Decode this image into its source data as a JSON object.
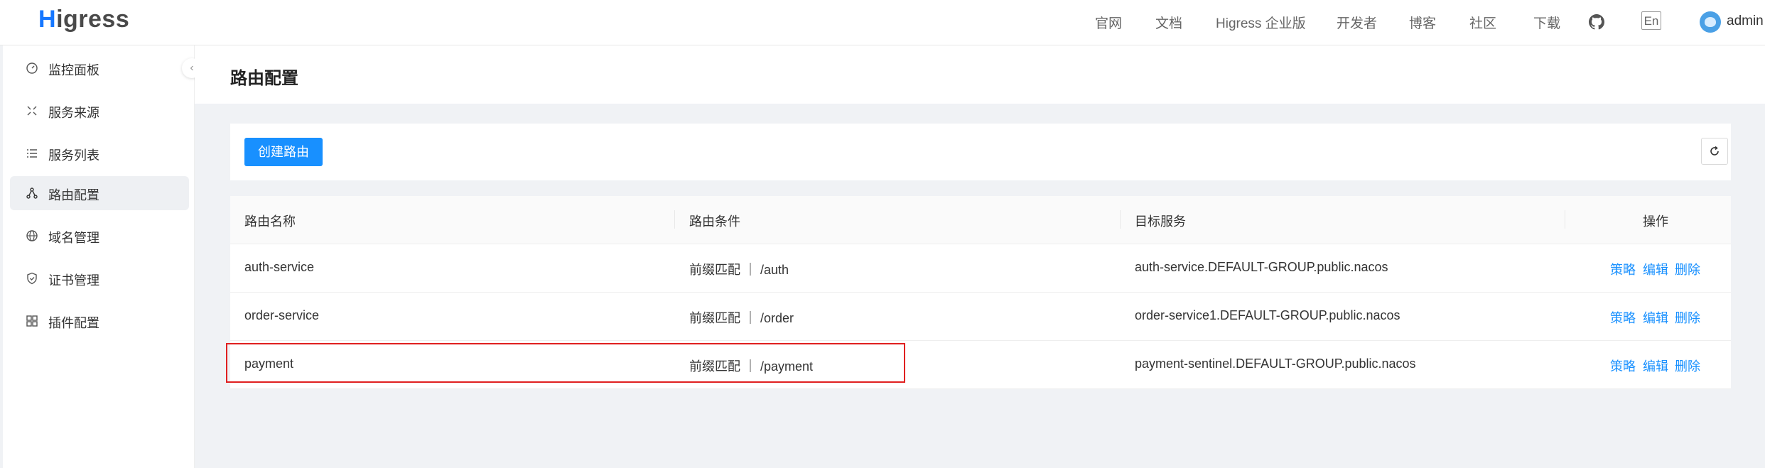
{
  "brand": {
    "logo_h": "H",
    "logo_rest": "igress"
  },
  "topnav": {
    "items": [
      "官网",
      "文档",
      "Higress 企业版",
      "开发者",
      "博客",
      "社区",
      "下载"
    ],
    "github_icon": "github-icon",
    "lang": "En",
    "user": "admin"
  },
  "sidebar": {
    "items": [
      {
        "label": "监控面板",
        "icon": "dashboard-icon"
      },
      {
        "label": "服务来源",
        "icon": "service-source-icon"
      },
      {
        "label": "服务列表",
        "icon": "list-icon"
      },
      {
        "label": "路由配置",
        "icon": "route-icon",
        "active": true
      },
      {
        "label": "域名管理",
        "icon": "globe-icon"
      },
      {
        "label": "证书管理",
        "icon": "shield-icon"
      },
      {
        "label": "插件配置",
        "icon": "plugin-icon"
      }
    ],
    "collapse_glyph": "‹"
  },
  "page": {
    "title": "路由配置"
  },
  "toolbar": {
    "create_label": "创建路由"
  },
  "table": {
    "headers": [
      "路由名称",
      "路由条件",
      "目标服务",
      "操作"
    ],
    "rows": [
      {
        "name": "auth-service",
        "condition": "前缀匹配 ｜ /auth",
        "target": "auth-service.DEFAULT-GROUP.public.nacos"
      },
      {
        "name": "order-service",
        "condition": "前缀匹配 ｜ /order",
        "target": "order-service1.DEFAULT-GROUP.public.nacos"
      },
      {
        "name": "payment",
        "condition": "前缀匹配 ｜ /payment",
        "target": "payment-sentinel.DEFAULT-GROUP.public.nacos"
      }
    ],
    "actions": [
      "策略",
      "编辑",
      "删除"
    ]
  },
  "colors": {
    "primary": "#1890ff",
    "highlight": "#e02020"
  }
}
